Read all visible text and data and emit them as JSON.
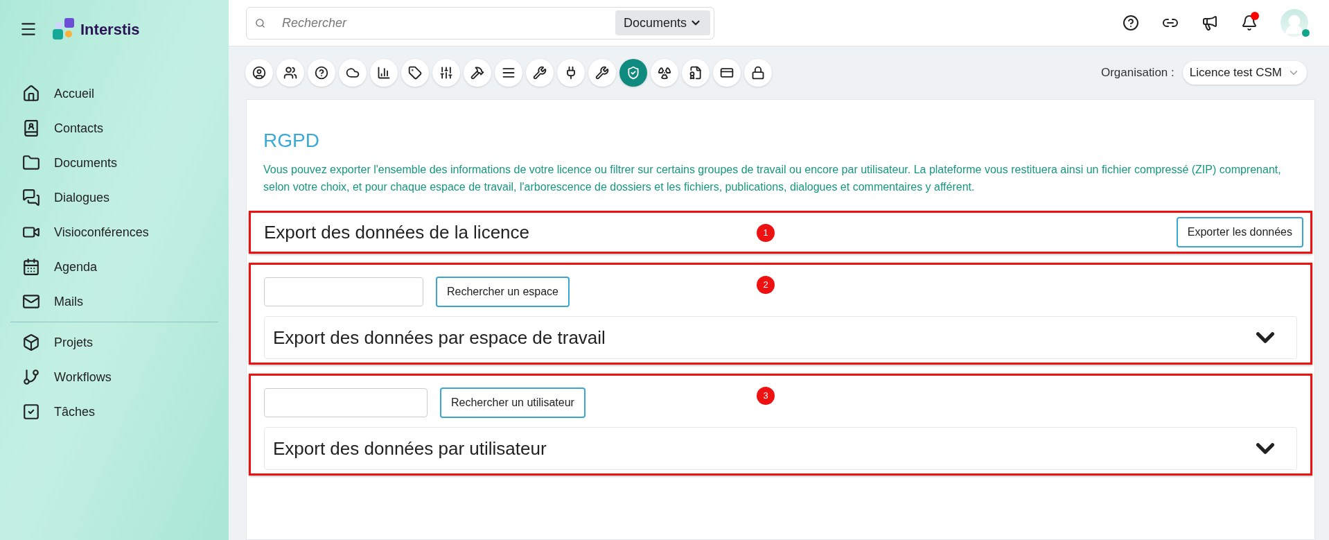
{
  "app": {
    "name": "Interstis"
  },
  "sidebar": {
    "groups": [
      {
        "items": [
          {
            "label": "Accueil"
          },
          {
            "label": "Contacts"
          },
          {
            "label": "Documents"
          },
          {
            "label": "Dialogues"
          },
          {
            "label": "Visioconférences"
          },
          {
            "label": "Agenda"
          },
          {
            "label": "Mails"
          }
        ]
      },
      {
        "items": [
          {
            "label": "Projets"
          },
          {
            "label": "Workflows"
          },
          {
            "label": "Tâches"
          }
        ]
      }
    ]
  },
  "search": {
    "placeholder": "Rechercher",
    "scope": "Documents"
  },
  "header": {
    "notifications_unread": true,
    "user_online": true
  },
  "toolbar": [
    {
      "selected": false
    },
    {
      "selected": false
    },
    {
      "selected": false
    },
    {
      "selected": false
    },
    {
      "selected": false
    },
    {
      "selected": false
    },
    {
      "selected": false
    },
    {
      "selected": false
    },
    {
      "selected": false
    },
    {
      "selected": false
    },
    {
      "selected": false
    },
    {
      "selected": false
    },
    {
      "selected": true
    },
    {
      "selected": false
    },
    {
      "selected": false
    },
    {
      "selected": false
    },
    {
      "selected": false
    }
  ],
  "organisation": {
    "label": "Organisation :",
    "value": "Licence test CSM"
  },
  "page": {
    "title": "RGPD",
    "description": "Vous pouvez exporter l'ensemble des informations de votre licence ou filtrer sur certains groupes de travail ou encore par utilisateur. La plateforme vous restituera ainsi un fichier compressé (ZIP) comprenant, selon votre choix, et pour chaque espace de travail, l'arborescence de dossiers et les fichiers, publications, dialogues et commentaires y afférent."
  },
  "sections": [
    {
      "kind": "export",
      "title": "Export des données de la licence",
      "button": "Exporter les données",
      "annotation": "1"
    },
    {
      "kind": "search",
      "search_button": "Rechercher un espace",
      "title": "Export des données par espace de travail",
      "expanded": false,
      "annotation": "2"
    },
    {
      "kind": "search",
      "search_button": "Rechercher un utilisateur",
      "title": "Export des données par utilisateur",
      "expanded": false,
      "annotation": "3"
    }
  ]
}
